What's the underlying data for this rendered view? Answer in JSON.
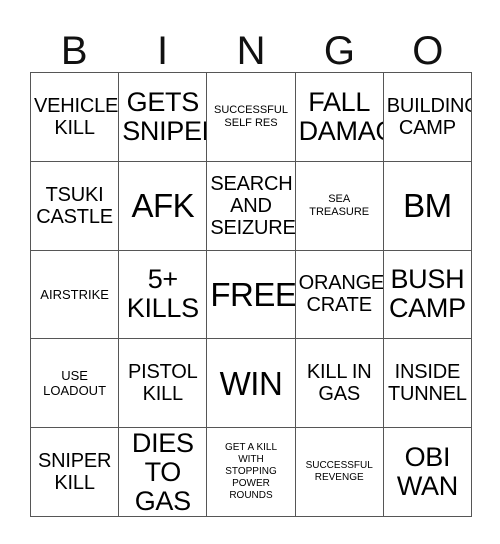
{
  "card": {
    "title": "BINGO",
    "header_letters": [
      "B",
      "I",
      "N",
      "G",
      "O"
    ],
    "grid_size": "5x5",
    "colors": {
      "background": "#ffffff",
      "border": "#565656",
      "text": "#000000"
    },
    "free_space": "FREE",
    "cells": [
      {
        "text": "VEHICLE\nKILL",
        "size": "md"
      },
      {
        "text": "GETS\nSNIPED",
        "size": "lg"
      },
      {
        "text": "SUCCESSFUL\nSELF RES",
        "size": "xs"
      },
      {
        "text": "FALL\nDAMAGE",
        "size": "lg"
      },
      {
        "text": "BUILDING\nCAMP",
        "size": "md"
      },
      {
        "text": "TSUKI\nCASTLE",
        "size": "md"
      },
      {
        "text": "AFK",
        "size": "xl"
      },
      {
        "text": "SEARCH\nAND\nSEIZURE",
        "size": "md"
      },
      {
        "text": "SEA\nTREASURE",
        "size": "xs"
      },
      {
        "text": "BM",
        "size": "xl"
      },
      {
        "text": "AIRSTRIKE",
        "size": "sm"
      },
      {
        "text": "5+\nKILLS",
        "size": "lg"
      },
      {
        "text": "FREE",
        "size": "xl"
      },
      {
        "text": "ORANGE\nCRATE",
        "size": "md"
      },
      {
        "text": "BUSH\nCAMP",
        "size": "lg"
      },
      {
        "text": "USE\nLOADOUT",
        "size": "sm"
      },
      {
        "text": "PISTOL\nKILL",
        "size": "md"
      },
      {
        "text": "WIN",
        "size": "xl"
      },
      {
        "text": "KILL IN\nGAS",
        "size": "md"
      },
      {
        "text": "INSIDE\nTUNNEL",
        "size": "md"
      },
      {
        "text": "SNIPER\nKILL",
        "size": "md"
      },
      {
        "text": "DIES\nTO\nGAS",
        "size": "lg"
      },
      {
        "text": "GET A KILL\nWITH\nSTOPPING\nPOWER\nROUNDS",
        "size": "xxs"
      },
      {
        "text": "SUCCESSFUL\nREVENGE",
        "size": "xxs"
      },
      {
        "text": "OBI\nWAN",
        "size": "lg"
      }
    ]
  }
}
